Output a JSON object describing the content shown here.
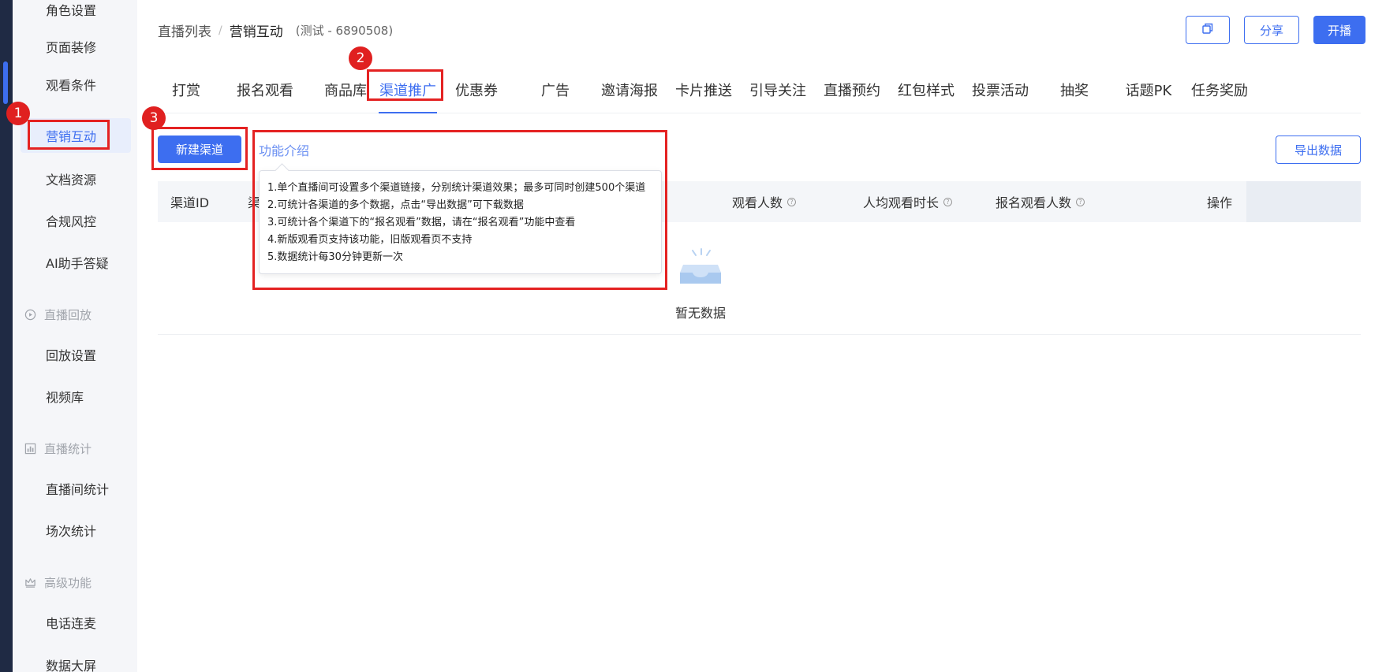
{
  "sidebar": {
    "items": [
      {
        "label": "角色设置"
      },
      {
        "label": "页面装修"
      },
      {
        "label": "观看条件"
      },
      {
        "label": "营销互动",
        "active": true
      },
      {
        "label": "文档资源"
      },
      {
        "label": "合规风控"
      },
      {
        "label": "AI助手答疑"
      },
      {
        "label": "回放设置"
      },
      {
        "label": "视频库"
      },
      {
        "label": "直播间统计"
      },
      {
        "label": "场次统计"
      },
      {
        "label": "电话连麦"
      },
      {
        "label": "数据大屏"
      }
    ],
    "groups": [
      {
        "label": "直播回放",
        "icon": "replay-icon"
      },
      {
        "label": "直播统计",
        "icon": "chart-icon"
      },
      {
        "label": "高级功能",
        "icon": "crown-icon"
      }
    ]
  },
  "breadcrumb": {
    "parent": "直播列表",
    "separator": "/",
    "current": "营销互动",
    "room": "(测试 - 6890508)"
  },
  "header": {
    "copy_icon": "copy-icon",
    "share_label": "分享",
    "start_label": "开播"
  },
  "tabs": [
    {
      "label": "打赏"
    },
    {
      "label": "报名观看"
    },
    {
      "label": "商品库"
    },
    {
      "label": "渠道推广",
      "active": true
    },
    {
      "label": "优惠券"
    },
    {
      "label": "广告"
    },
    {
      "label": "邀请海报"
    },
    {
      "label": "卡片推送"
    },
    {
      "label": "引导关注"
    },
    {
      "label": "直播预约"
    },
    {
      "label": "红包样式"
    },
    {
      "label": "投票活动"
    },
    {
      "label": "抽奖"
    },
    {
      "label": "话题PK"
    },
    {
      "label": "任务奖励"
    }
  ],
  "markers": [
    "1",
    "2",
    "3"
  ],
  "toolbar": {
    "new_channel_label": "新建渠道",
    "intro_label": "功能介绍",
    "export_label": "导出数据"
  },
  "tooltip": {
    "lines": [
      "1.单个直播间可设置多个渠道链接，分别统计渠道效果；最多可同时创建500个渠道",
      "2.可统计各渠道的多个数据，点击“导出数据”可下载数据",
      "3.可统计各个渠道下的“报名观看”数据，请在“报名观看”功能中查看",
      "4.新版观看页支持该功能，旧版观看页不支持",
      "5.数据统计每30分钟更新一次"
    ]
  },
  "table": {
    "columns": [
      {
        "label": "渠道ID"
      },
      {
        "label": "渠"
      },
      {
        "label": "观看人数",
        "help": "?"
      },
      {
        "label": "人均观看时长",
        "help": "?"
      },
      {
        "label": "报名观看人数",
        "help": "?"
      },
      {
        "label": "操作"
      }
    ],
    "empty_text": "暂无数据"
  },
  "colors": {
    "primary": "#3d6ef0",
    "marker": "#e02020",
    "rail": "#1f2a44"
  }
}
